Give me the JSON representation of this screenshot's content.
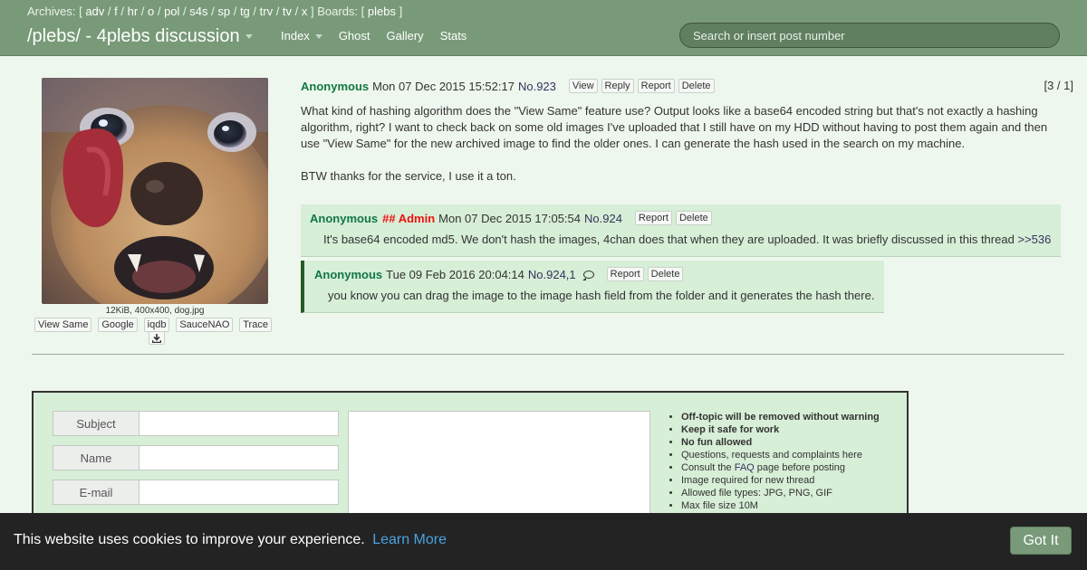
{
  "header": {
    "archives_label": "Archives:",
    "archive_boards": [
      "adv",
      "f",
      "hr",
      "o",
      "pol",
      "s4s",
      "sp",
      "tg",
      "trv",
      "tv",
      "x"
    ],
    "boards_label": "Boards:",
    "boards": [
      "plebs"
    ],
    "site_title": "/plebs/ - 4plebs discussion",
    "nav": [
      "Index",
      "Ghost",
      "Gallery",
      "Stats"
    ],
    "search_placeholder": "Search or insert post number"
  },
  "op": {
    "thumbnail_icon": "chihuahua-photo",
    "file_info": "12KiB, 400x400, dog.jpg",
    "thumb_actions": [
      "View Same",
      "Google",
      "iqdb",
      "SauceNAO",
      "Trace"
    ],
    "download_icon": "download-icon",
    "author": "Anonymous",
    "date": "Mon 07 Dec 2015 15:52:17",
    "post_no": "No.923",
    "actions": [
      "View",
      "Reply",
      "Report",
      "Delete"
    ],
    "counter": "[3 / 1]",
    "text": [
      "What kind of hashing algorithm does the \"View Same\" feature use? Output looks like a base64 encoded string but that's not exactly a hashing algorithm, right? I want to check back on some old images I've uploaded that I still have on my HDD without having to post them again and then use \"View Same\" for the new archived image to find the older ones. I can generate the hash used in the search on my machine.",
      "BTW thanks for the service, I use it a ton."
    ]
  },
  "replies": [
    {
      "author": "Anonymous",
      "capcode": "## Admin",
      "date": "Mon 07 Dec 2015 17:05:54",
      "post_no": "No.924",
      "actions": [
        "Report",
        "Delete"
      ],
      "text": "It's base64 encoded md5. We don't hash the images, 4chan does that when they are uploaded. It was briefly discussed in this thread",
      "quote": ">>536"
    },
    {
      "author": "Anonymous",
      "date": "Tue 09 Feb 2016 20:04:14",
      "post_no": "No.924,1",
      "actions": [
        "Report",
        "Delete"
      ],
      "text": "you know you can drag the image to the image hash field from the folder and it generates the hash there."
    }
  ],
  "form": {
    "fields": [
      "Subject",
      "Name",
      "E-mail"
    ],
    "rules": [
      "Off-topic will be removed without warning",
      "Keep it safe for work",
      "No fun allowed",
      "Questions, requests and complaints here",
      "Consult the",
      "FAQ",
      "page before posting",
      "Image required for new thread",
      "Allowed file types: JPG, PNG, GIF",
      "Max file size 10M"
    ]
  },
  "cookie": {
    "message": "This website uses cookies to improve your experience.",
    "link": "Learn More",
    "button": "Got It"
  },
  "colors": {
    "header_bg": "#789a78",
    "page_bg": "#eef7ee",
    "reply_bg": "#d7eed7",
    "author": "#117743",
    "admin": "#ee1111",
    "link": "#34345c",
    "cookie_bg": "#232323",
    "cookie_link": "#4aa3df"
  }
}
